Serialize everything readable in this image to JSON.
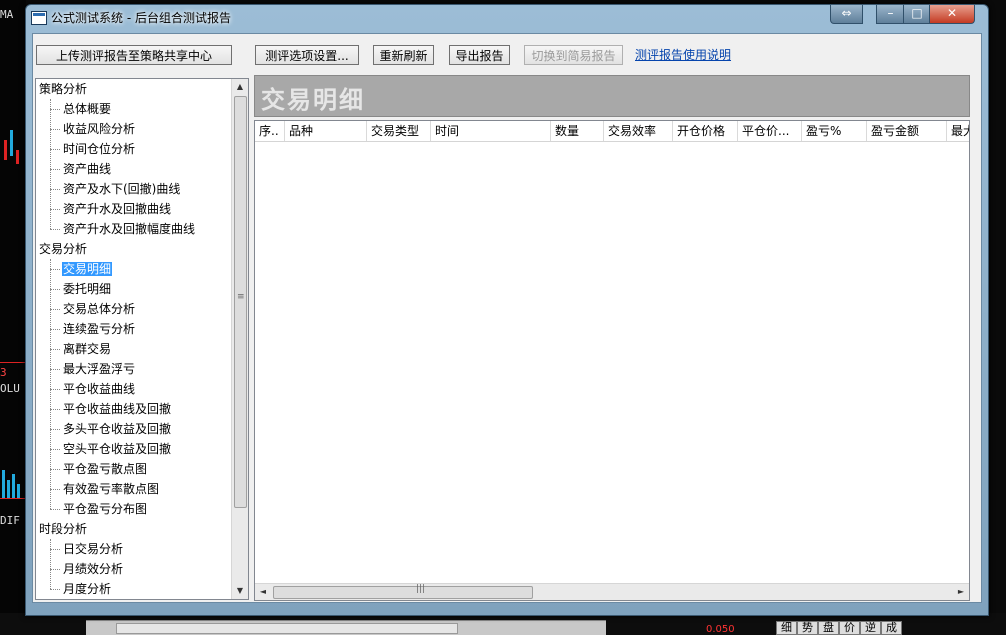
{
  "window": {
    "title": "公式测试系统 - 后台组合测试报告",
    "restore_glyph": "⇔",
    "min_glyph": "–",
    "max_glyph": "□",
    "close_glyph": "✕"
  },
  "toolbar": {
    "upload_label": "上传测评报告至策略共享中心",
    "options_label": "测评选项设置...",
    "refresh_label": "重新刷新",
    "export_label": "导出报告",
    "switch_label": "切换到简易报告",
    "help_link": "测评报告使用说明"
  },
  "tree": {
    "items": [
      {
        "label": "策略分析",
        "type": "category"
      },
      {
        "label": "总体概要",
        "type": "child"
      },
      {
        "label": "收益风险分析",
        "type": "child"
      },
      {
        "label": "时间仓位分析",
        "type": "child"
      },
      {
        "label": "资产曲线",
        "type": "child"
      },
      {
        "label": "资产及水下(回撤)曲线",
        "type": "child"
      },
      {
        "label": "资产升水及回撤曲线",
        "type": "child"
      },
      {
        "label": "资产升水及回撤幅度曲线",
        "type": "child"
      },
      {
        "label": "交易分析",
        "type": "category"
      },
      {
        "label": "交易明细",
        "type": "child",
        "selected": true
      },
      {
        "label": "委托明细",
        "type": "child"
      },
      {
        "label": "交易总体分析",
        "type": "child"
      },
      {
        "label": "连续盈亏分析",
        "type": "child"
      },
      {
        "label": "离群交易",
        "type": "child"
      },
      {
        "label": "最大浮盈浮亏",
        "type": "child"
      },
      {
        "label": "平仓收益曲线",
        "type": "child"
      },
      {
        "label": "平仓收益曲线及回撤",
        "type": "child"
      },
      {
        "label": "多头平仓收益及回撤",
        "type": "child"
      },
      {
        "label": "空头平仓收益及回撤",
        "type": "child"
      },
      {
        "label": "平仓盈亏散点图",
        "type": "child"
      },
      {
        "label": "有效盈亏率散点图",
        "type": "child"
      },
      {
        "label": "平仓盈亏分布图",
        "type": "child"
      },
      {
        "label": "时段分析",
        "type": "category"
      },
      {
        "label": "日交易分析",
        "type": "child"
      },
      {
        "label": "月绩效分析",
        "type": "child"
      },
      {
        "label": "月度分析",
        "type": "child"
      }
    ],
    "grip_glyph": "≡"
  },
  "panel": {
    "title": "交易明细",
    "columns": [
      "序..",
      "品种",
      "交易类型",
      "时间",
      "数量",
      "交易效率",
      "开仓价格",
      "平仓价...",
      "盈亏%",
      "盈亏金额",
      "最大"
    ]
  },
  "scroll": {
    "up": "▲",
    "down": "▼",
    "left": "◄",
    "right": "►",
    "grip": "|||"
  },
  "background": {
    "labels": [
      "MA",
      "OLU",
      "DIF",
      "3"
    ],
    "bottom_num": "0.050",
    "bottom_tabs": [
      "细",
      "势",
      "盘",
      "价",
      "逆",
      "成"
    ]
  }
}
